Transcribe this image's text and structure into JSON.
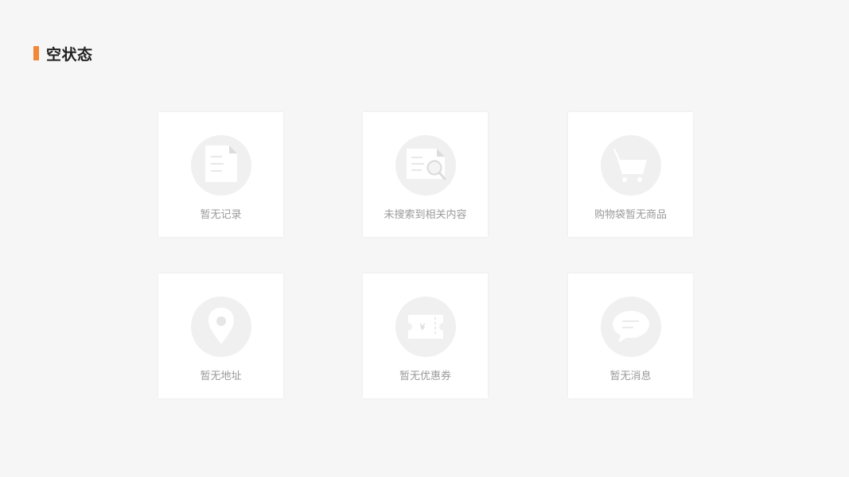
{
  "section": {
    "title": "空状态",
    "accent_color": "#f2873a"
  },
  "cards": [
    {
      "label": "暂无记录",
      "icon": "document-icon"
    },
    {
      "label": "未搜索到相关内容",
      "icon": "search-document-icon"
    },
    {
      "label": "购物袋暂无商品",
      "icon": "shopping-cart-icon"
    },
    {
      "label": "暂无地址",
      "icon": "location-pin-icon"
    },
    {
      "label": "暂无优惠券",
      "icon": "coupon-icon"
    },
    {
      "label": "暂无消息",
      "icon": "chat-bubble-icon"
    }
  ],
  "coupon_symbol": "¥"
}
